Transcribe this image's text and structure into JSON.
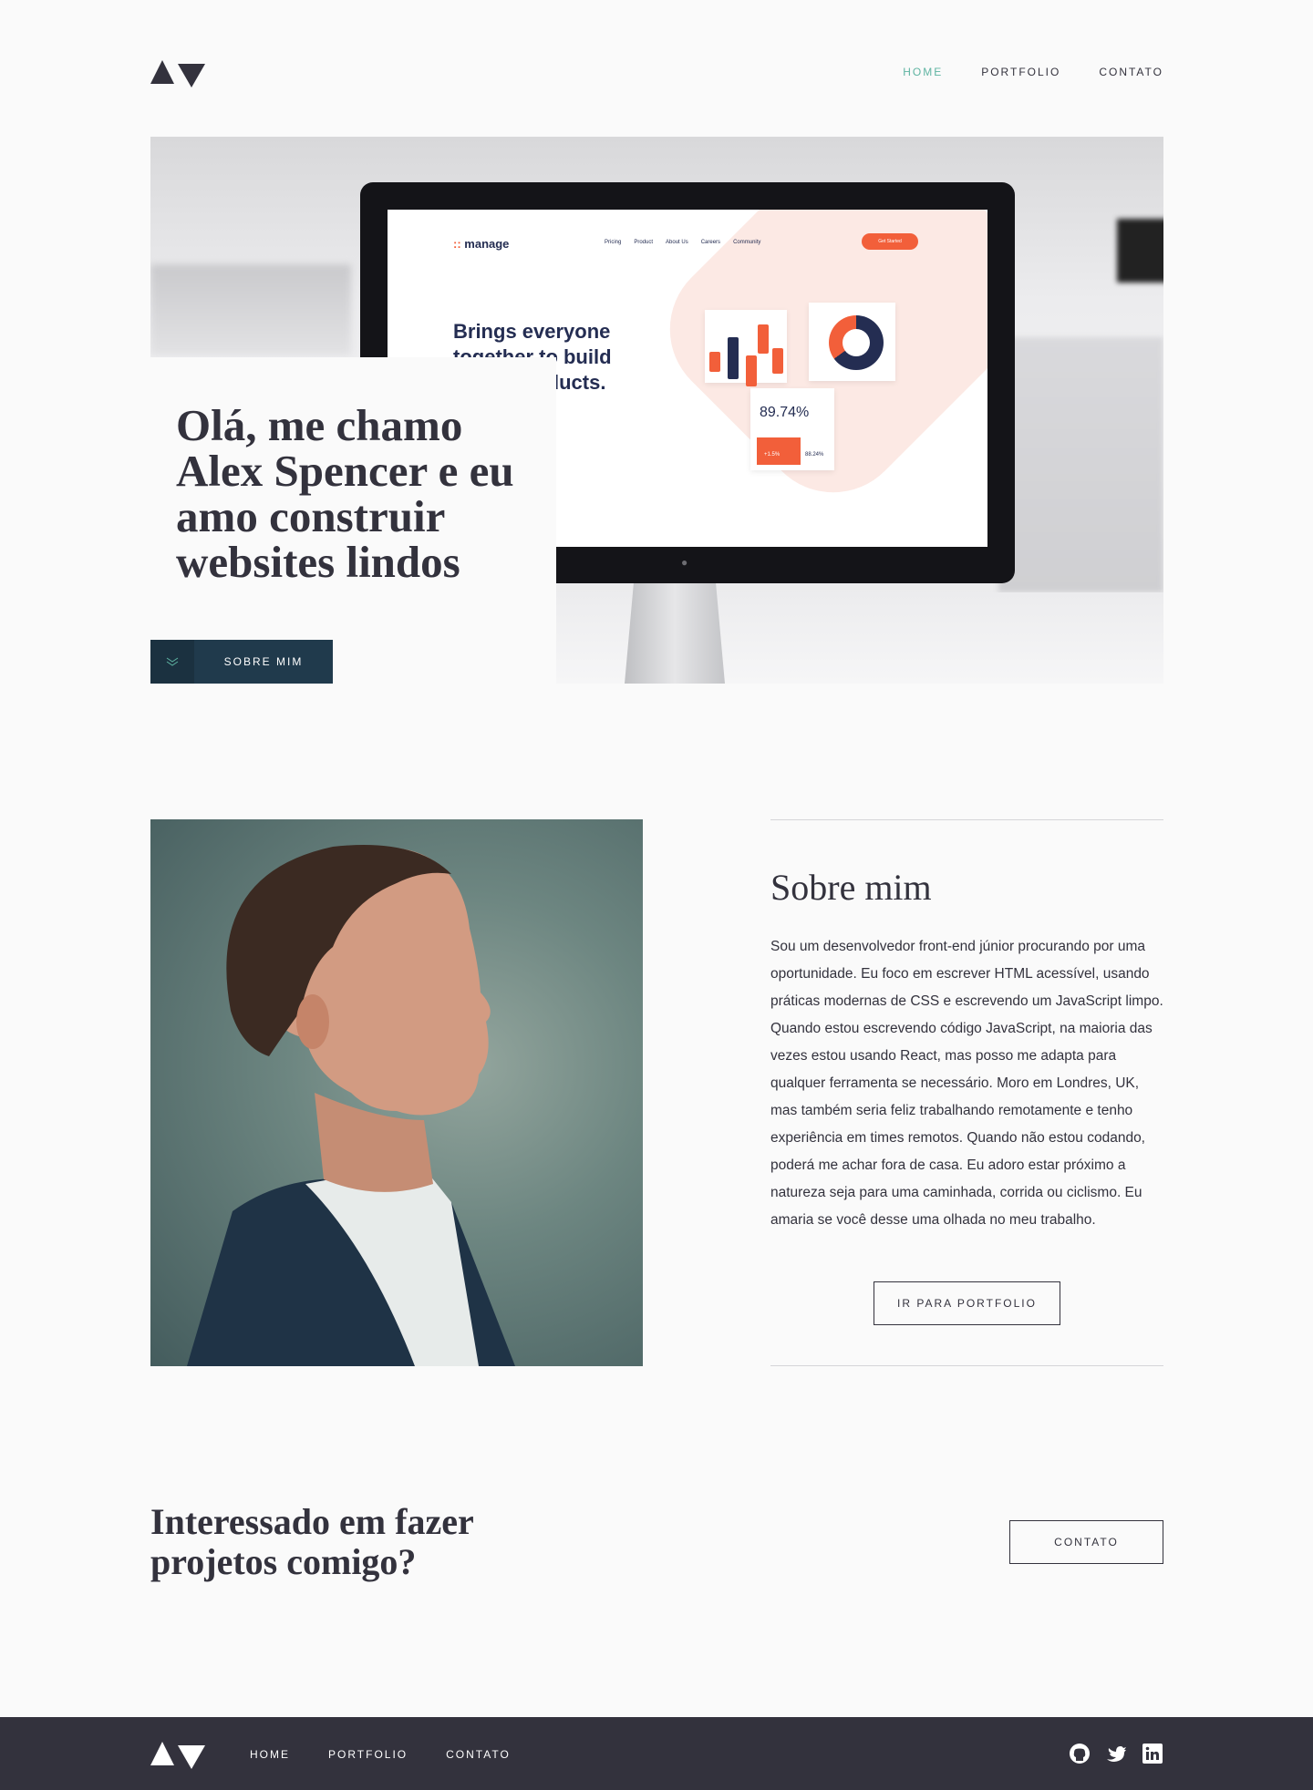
{
  "header": {
    "nav": [
      {
        "label": "HOME",
        "active": true
      },
      {
        "label": "PORTFOLIO",
        "active": false
      },
      {
        "label": "CONTATO",
        "active": false
      }
    ]
  },
  "hero": {
    "title": "Olá, me chamo Alex Spencer e eu amo construir websites lindos",
    "button_label": "SOBRE MIM",
    "screen": {
      "logo": "manage",
      "nav": [
        "Pricing",
        "Product",
        "About Us",
        "Careers",
        "Community"
      ],
      "cta": "Get Started",
      "headline": "Brings everyone together to build better products.",
      "stat_value": "89.74%",
      "stat_a": "+1.5%",
      "stat_b": "88.24%"
    }
  },
  "about": {
    "title": "Sobre mim",
    "text": "Sou um desenvolvedor front-end júnior procurando por uma oportunidade. Eu foco em escrever HTML acessível, usando práticas modernas de CSS e escrevendo um JavaScript limpo. Quando estou escrevendo código JavaScript, na maioria das vezes estou usando React, mas posso me adapta para qualquer ferramenta se necessário. Moro em Londres, UK, mas também seria feliz trabalhando remotamente e tenho experiência em times remotos. Quando não estou codando, poderá me achar fora de casa. Eu adoro estar próximo a natureza seja para uma caminhada, corrida ou ciclismo. Eu amaria se você desse uma olhada no meu trabalho.",
    "button_label": "IR PARA PORTFOLIO"
  },
  "cta": {
    "title": "Interessado em fazer projetos comigo?",
    "button_label": "CONTATO"
  },
  "footer": {
    "nav": [
      "HOME",
      "PORTFOLIO",
      "CONTATO"
    ],
    "social": [
      "github-icon",
      "twitter-icon",
      "linkedin-icon"
    ]
  },
  "colors": {
    "background": "#fafafa",
    "dark": "#33323d",
    "accent": "#5fb4a2",
    "button_dark": "#203a4c"
  }
}
